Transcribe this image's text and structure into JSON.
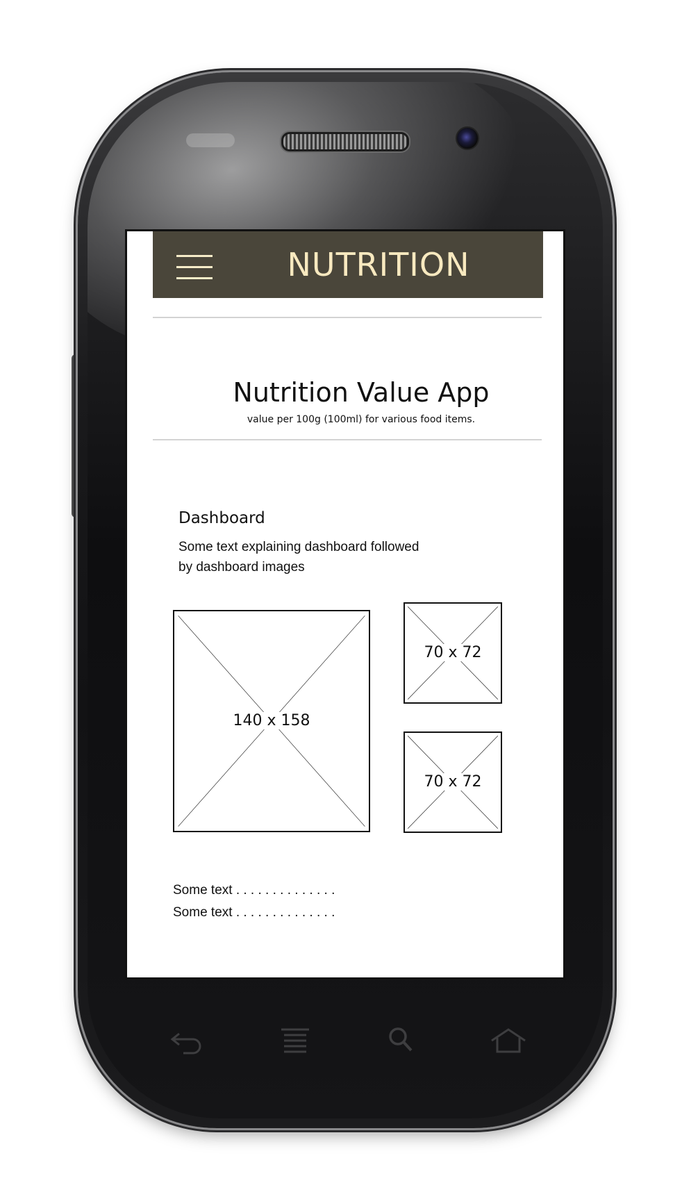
{
  "app": {
    "header_title": "NUTRITION",
    "menu_icon": "hamburger-menu-icon"
  },
  "hero": {
    "title": "Nutrition Value App",
    "subtitle": "value per 100g (100ml) for various food items."
  },
  "dashboard": {
    "heading": "Dashboard",
    "text_line1": "Some text explaining dashboard followed",
    "text_line2": "by dashboard images",
    "images": [
      {
        "label": "140 x 158"
      },
      {
        "label": "70 x 72"
      },
      {
        "label": "70 x 72"
      }
    ]
  },
  "footer": {
    "lines": [
      "Some text . . . . . . . . . . . . . .",
      "Some text . . . . . . . . . . . . . ."
    ]
  },
  "device": {
    "nav_buttons": [
      "back-icon",
      "menu-lines-icon",
      "search-icon",
      "home-icon"
    ],
    "colors": {
      "header_bg": "#4a463a",
      "header_text": "#f8e9bf",
      "body": "#121214"
    }
  }
}
